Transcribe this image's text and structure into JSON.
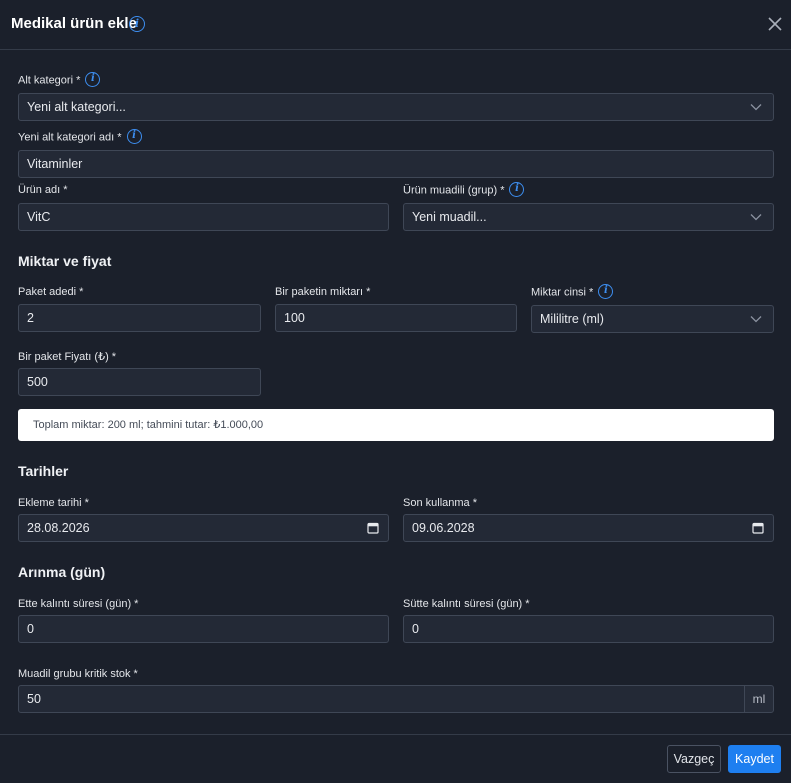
{
  "modal": {
    "title": "Medikal ürün ekle",
    "close_label": "×"
  },
  "form": {
    "subcategory": {
      "label": "Alt kategori *",
      "value": "Yeni alt kategori..."
    },
    "new_subcategory_name": {
      "label": "Yeni alt kategori adı *",
      "value": "Vitaminler"
    },
    "product_name": {
      "label": "Ürün adı *",
      "value": "VitC"
    },
    "product_equivalent": {
      "label": "Ürün muadili (grup) *",
      "value": "Yeni muadil..."
    }
  },
  "quantity_price": {
    "section_title": "Miktar ve fiyat",
    "package_count": {
      "label": "Paket adedi *",
      "value": "2"
    },
    "package_amount": {
      "label": "Bir paketin miktarı *",
      "value": "100"
    },
    "unit_type": {
      "label": "Miktar cinsi *",
      "value": "Mililitre (ml)"
    },
    "package_price": {
      "label": "Bir paket Fiyatı (₺) *",
      "value": "500"
    },
    "summary": "Toplam miktar: 200 ml; tahmini tutar: ₺1.000,00"
  },
  "dates": {
    "section_title": "Tarihler",
    "added_date": {
      "label": "Ekleme tarihi *",
      "value": "28.08.2026"
    },
    "expiry_date": {
      "label": "Son kullanma *",
      "value": "09.06.2028"
    }
  },
  "withdrawal": {
    "section_title": "Arınma (gün)",
    "meat_residue": {
      "label": "Ette kalıntı süresi (gün) *",
      "value": "0"
    },
    "milk_residue": {
      "label": "Sütte kalıntı süresi (gün) *",
      "value": "0"
    }
  },
  "critical_stock": {
    "label": "Muadil grubu kritik stok *",
    "value": "50",
    "unit": "ml"
  },
  "footer": {
    "cancel_label": "Vazgeç",
    "save_label": "Kaydet"
  },
  "colors": {
    "background": "#1b202b",
    "field_background": "#232936",
    "accent": "#1e7ff0",
    "info_icon": "#3d8ef0"
  },
  "icons": [
    "info-icon",
    "close-icon",
    "chevron-down-icon",
    "calendar-icon"
  ]
}
